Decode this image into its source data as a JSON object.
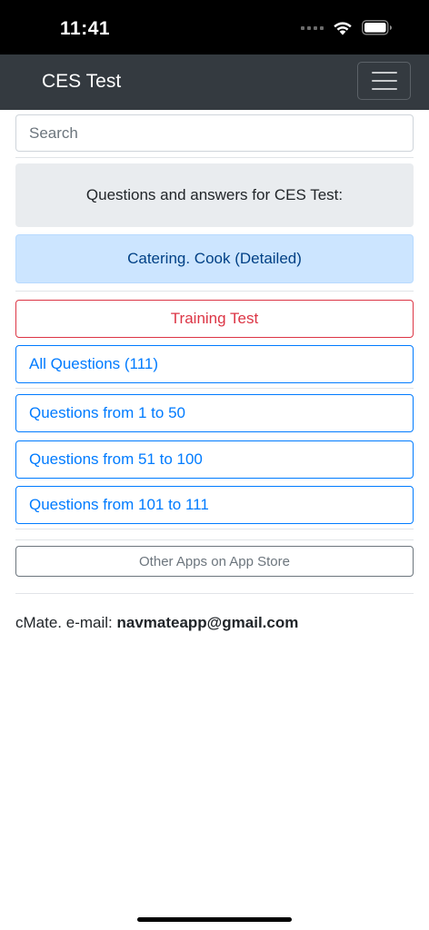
{
  "status_bar": {
    "time": "11:41"
  },
  "navbar": {
    "title": "CES Test"
  },
  "search": {
    "placeholder": "Search"
  },
  "header_box": {
    "text": "Questions and answers for CES Test:"
  },
  "topic_box": {
    "text": "Catering. Cook (Detailed)"
  },
  "buttons": {
    "training_test": "Training Test",
    "all_questions": "All Questions (111)",
    "range_1": "Questions from 1 to 50",
    "range_2": "Questions from 51 to 100",
    "range_3": "Questions from 101 to 111",
    "other_apps": "Other Apps on App Store"
  },
  "footer": {
    "label": "cMate. e-mail: ",
    "email": "navmateapp@gmail.com"
  },
  "colors": {
    "navbar_bg": "#343a40",
    "primary": "#007bff",
    "danger": "#dc3545",
    "secondary": "#6c757d",
    "info_bg": "#cce5ff",
    "light_bg": "#e9ecef"
  }
}
